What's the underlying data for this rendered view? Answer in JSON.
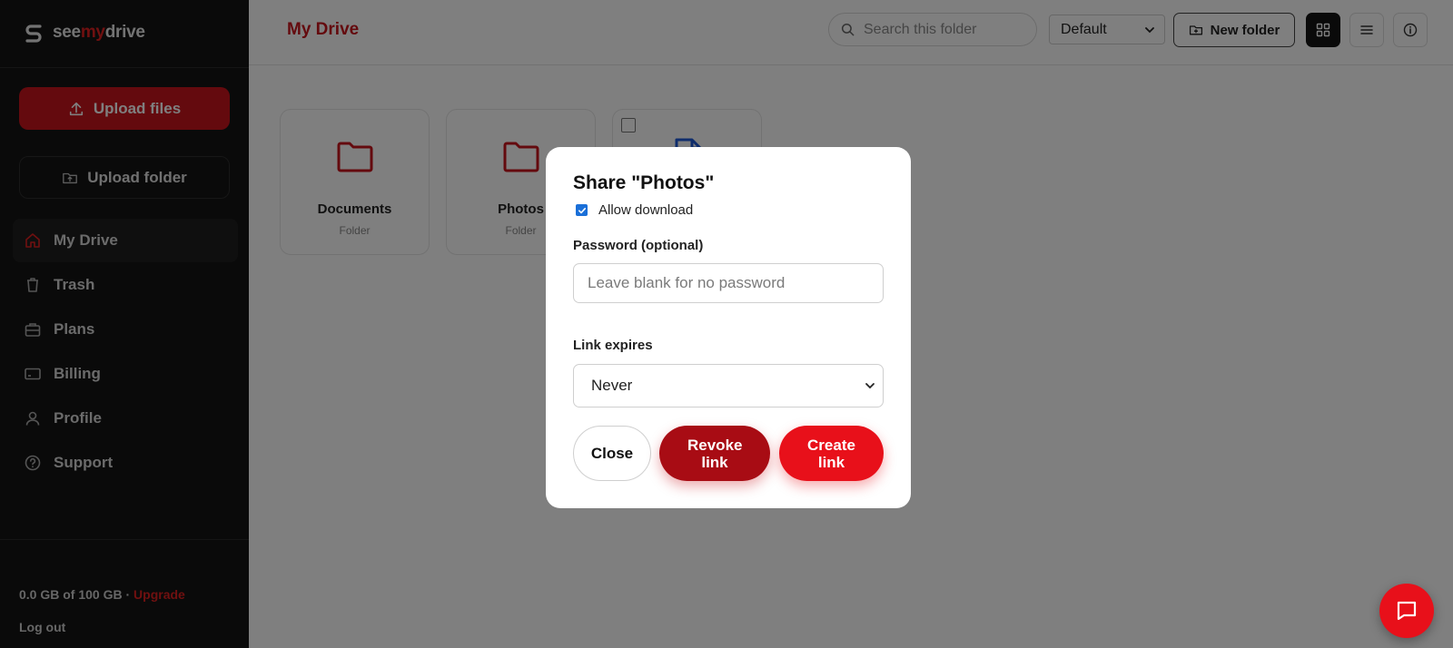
{
  "brand": {
    "prefix": "see",
    "accent": "my",
    "suffix": "drive"
  },
  "sidebar": {
    "upload_files_label": "Upload files",
    "upload_folder_label": "Upload folder",
    "items": [
      {
        "label": "My Drive",
        "icon": "home-icon",
        "active": true
      },
      {
        "label": "Trash",
        "icon": "trash-icon",
        "active": false
      },
      {
        "label": "Plans",
        "icon": "briefcase-icon",
        "active": false
      },
      {
        "label": "Billing",
        "icon": "card-icon",
        "active": false
      },
      {
        "label": "Profile",
        "icon": "user-icon",
        "active": false
      },
      {
        "label": "Support",
        "icon": "help-icon",
        "active": false
      }
    ],
    "storage_text": "0.0 GB of 100 GB · ",
    "upgrade_label": "Upgrade",
    "logout_label": "Log out"
  },
  "header": {
    "title": "My Drive",
    "search_placeholder": "Search this folder",
    "sort_value": "Default",
    "new_folder_label": "New folder"
  },
  "files": [
    {
      "name": "Documents",
      "type": "Folder"
    },
    {
      "name": "Photos",
      "type": "Folder"
    }
  ],
  "modal": {
    "title": "Share \"Photos\"",
    "allow_download_label": "Allow download",
    "allow_download_checked": true,
    "password_label": "Password (optional)",
    "password_placeholder": "Leave blank for no password",
    "expires_label": "Link expires",
    "expires_value": "Never",
    "close_label": "Close",
    "revoke_label": "Revoke link",
    "create_label": "Create link"
  },
  "colors": {
    "brand_red": "#e8101a",
    "dark_red": "#a80c14",
    "sidebar_bg": "#141414",
    "checkbox_blue": "#1a6fd8"
  }
}
